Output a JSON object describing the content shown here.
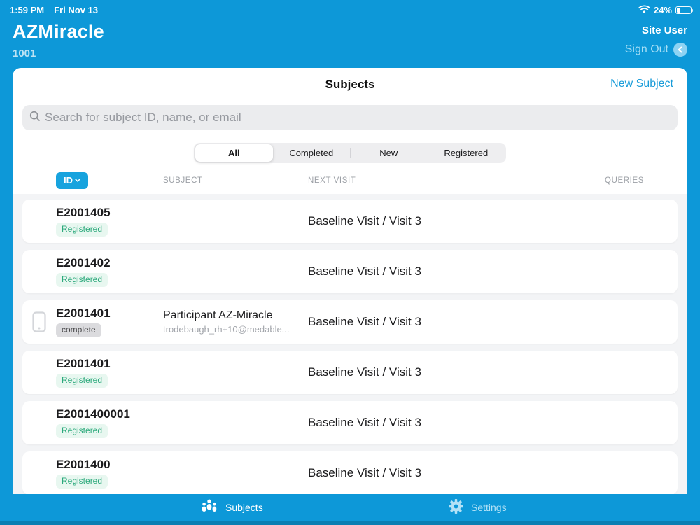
{
  "status_bar": {
    "time": "1:59 PM",
    "date": "Fri Nov 13",
    "battery": "24%"
  },
  "header": {
    "app_title": "AZMiracle",
    "site_id": "1001",
    "user_label": "Site User",
    "sign_out_label": "Sign Out"
  },
  "subjects_panel": {
    "title": "Subjects",
    "new_subject_label": "New Subject",
    "search_placeholder": "Search for subject ID, name, or email",
    "filters": [
      "All",
      "Completed",
      "New",
      "Registered"
    ],
    "active_filter": "All",
    "columns": {
      "id": "ID",
      "subject": "SUBJECT",
      "next_visit": "NEXT VISIT",
      "queries": "QUERIES"
    },
    "rows": [
      {
        "id": "E2001405",
        "status": "Registered",
        "status_type": "registered",
        "subject_name": "",
        "subject_email": "",
        "next_visit": "Baseline Visit / Visit 3",
        "has_device": false
      },
      {
        "id": "E2001402",
        "status": "Registered",
        "status_type": "registered",
        "subject_name": "",
        "subject_email": "",
        "next_visit": "Baseline Visit / Visit 3",
        "has_device": false
      },
      {
        "id": "E2001401",
        "status": "complete",
        "status_type": "complete",
        "subject_name": "Participant AZ-Miracle",
        "subject_email": "trodebaugh_rh+10@medable...",
        "next_visit": "Baseline Visit / Visit 3",
        "has_device": true
      },
      {
        "id": "E2001401",
        "status": "Registered",
        "status_type": "registered",
        "subject_name": "",
        "subject_email": "",
        "next_visit": "Baseline Visit / Visit 3",
        "has_device": false
      },
      {
        "id": "E2001400001",
        "status": "Registered",
        "status_type": "registered",
        "subject_name": "",
        "subject_email": "",
        "next_visit": "Baseline Visit / Visit 3",
        "has_device": false
      },
      {
        "id": "E2001400",
        "status": "Registered",
        "status_type": "registered",
        "subject_name": "",
        "subject_email": "",
        "next_visit": "Baseline Visit / Visit 3",
        "has_device": false
      }
    ]
  },
  "tab_bar": {
    "tabs": [
      {
        "label": "Subjects",
        "icon": "people-icon",
        "active": true
      },
      {
        "label": "Settings",
        "icon": "gear-icon",
        "active": false
      }
    ]
  },
  "colors": {
    "brand_blue": "#0D98D8",
    "link_blue": "#199CD9",
    "id_button_blue": "#17A3DE",
    "registered_green": "#2BA97B",
    "registered_bg": "#E8F7F0",
    "complete_gray": "#48484A",
    "complete_bg": "#DBDBDE",
    "tab_inactive": "#B3E2F6",
    "bottom_strip": "#0A7EB2"
  }
}
